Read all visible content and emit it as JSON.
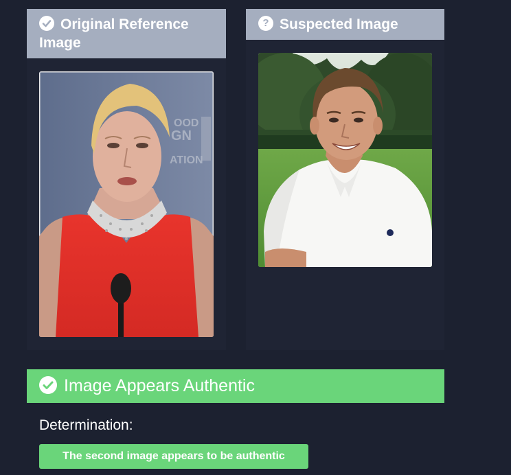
{
  "reference": {
    "title": "Original Reference Image",
    "icon": "check-circle-icon",
    "photo_description_icon": "reference-photo"
  },
  "suspected": {
    "title": "Suspected Image",
    "icon": "question-circle-icon",
    "photo_description_icon": "suspected-photo"
  },
  "result": {
    "title": "Image Appears Authentic",
    "icon": "check-circle-icon",
    "determination_label": "Determination:",
    "determination_value": "The second image appears to be authentic"
  },
  "colors": {
    "background": "#1c2130",
    "header": "#a5aebf",
    "success": "#6ad57a"
  }
}
